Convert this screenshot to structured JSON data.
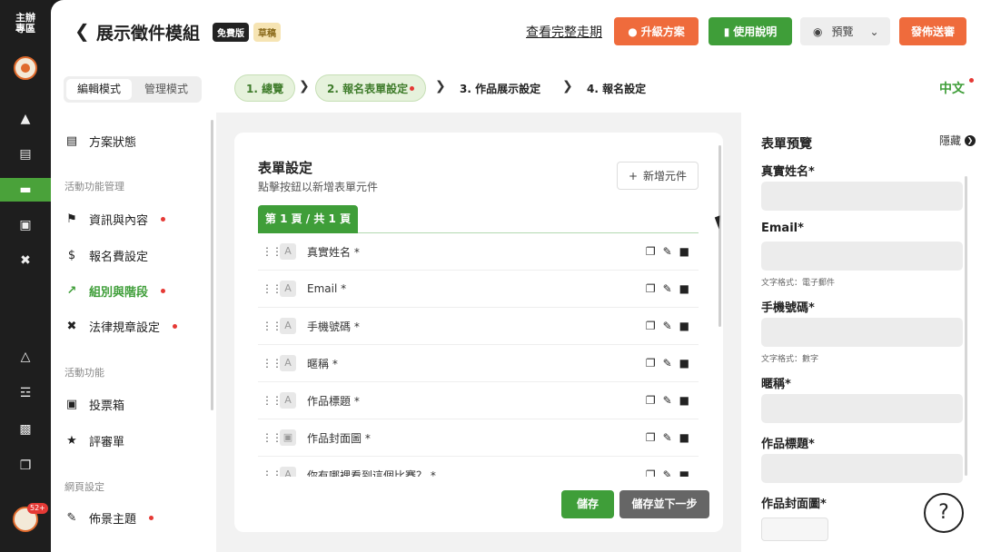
{
  "rail": {
    "brand": "主辦\n專區",
    "badge": "52+",
    "icons": [
      "pin-icon",
      "document-icon",
      "database-icon",
      "inbox-icon",
      "gavel-icon",
      "flask-icon",
      "sitemap-icon",
      "save-icon",
      "copy-icon"
    ]
  },
  "header": {
    "title": "展示徵件模組",
    "tag_free": "免費版",
    "tag_draft": "草稿",
    "full_link": "查看完整走期",
    "upgrade": "升級方案",
    "guide": "使用說明",
    "preview": "預覽",
    "publish": "發佈送審"
  },
  "sidebar": {
    "mode_edit": "編輯模式",
    "mode_manage": "管理模式",
    "status": "方案狀態",
    "section1": "活動功能管理",
    "info": "資訊與內容",
    "fee": "報名費設定",
    "groups": "組別與階段",
    "legal": "法律規章設定",
    "section2": "活動功能",
    "vote": "投票箱",
    "review": "評審單",
    "section3": "網頁設定",
    "theme": "佈景主題"
  },
  "steps": {
    "s1": "1. 總覽",
    "s2": "2. 報名表單設定",
    "s3": "3. 作品展示設定",
    "s4": "4. 報名設定",
    "lang": "中文"
  },
  "form": {
    "title": "表單設定",
    "subtitle": "點擊按鈕以新增表單元件",
    "add": "新增元件",
    "page_tab": "第 1 頁 / 共 1 頁",
    "rows": [
      {
        "label": "真實姓名 *",
        "type": "A"
      },
      {
        "label": "Email *",
        "type": "A"
      },
      {
        "label": "手機號碼 *",
        "type": "A"
      },
      {
        "label": "暱稱 *",
        "type": "A"
      },
      {
        "label": "作品標題 *",
        "type": "A"
      },
      {
        "label": "作品封面圖 *",
        "type": "▣"
      },
      {
        "label": "你有哪裡看到這個比賽？ *",
        "type": "A"
      }
    ],
    "save": "儲存",
    "save_next": "儲存並下一步"
  },
  "preview": {
    "title": "表單預覽",
    "hide": "隱藏",
    "f1": "真實姓名*",
    "f2": "Email*",
    "f2_hint": "文字格式：電子郵件",
    "f3": "手機號碼*",
    "f3_hint": "文字格式：數字",
    "f4": "暱稱*",
    "f5": "作品標題*",
    "f6": "作品封面圖*"
  },
  "help": "?"
}
